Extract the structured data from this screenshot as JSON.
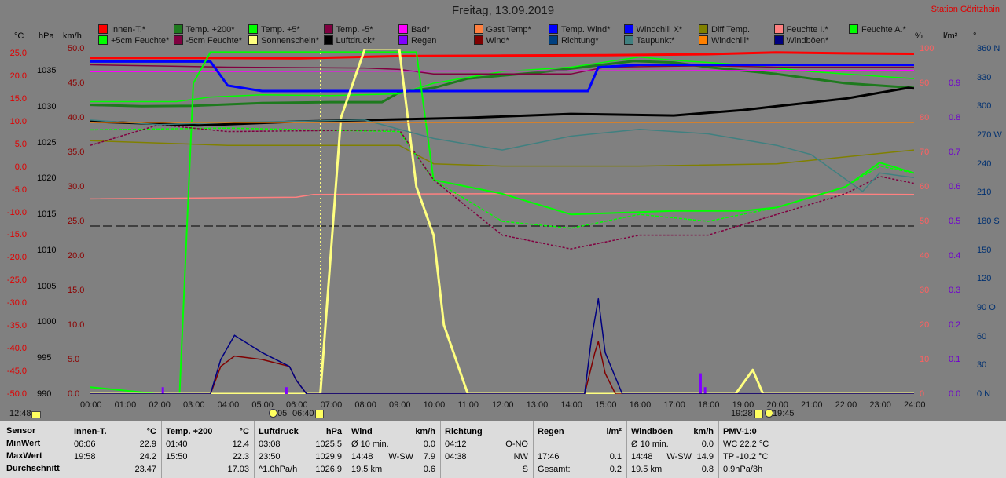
{
  "header": {
    "title": "Freitag, 13.09.2019",
    "station": "Station Göritzhain"
  },
  "legend": [
    {
      "label": "Innen-T.*",
      "color": "#ff0000"
    },
    {
      "label": "Temp. +200*",
      "color": "#1e7a1e"
    },
    {
      "label": "Temp. +5*",
      "color": "#00ff00"
    },
    {
      "label": "Temp. -5*",
      "color": "#800040"
    },
    {
      "label": "Bad*",
      "color": "#ff00ff"
    },
    {
      "label": "Gast Temp*",
      "color": "#ff8040"
    },
    {
      "label": "Temp. Wind*",
      "color": "#0000ff"
    },
    {
      "label": "Windchill X*",
      "color": "#0000ff"
    },
    {
      "label": "Diff Temp.",
      "color": "#808000"
    },
    {
      "label": "Feuchte I.*",
      "color": "#ff8080"
    },
    {
      "label": "Feuchte A.*",
      "color": "#00ff00"
    },
    {
      "label": "+5cm Feuchte*",
      "color": "#00ff00"
    },
    {
      "label": "-5cm Feuchte*",
      "color": "#800040"
    },
    {
      "label": "Sonnenschein*",
      "color": "#ffff80"
    },
    {
      "label": "Luftdruck*",
      "color": "#000000"
    },
    {
      "label": "Regen",
      "color": "#8000ff"
    },
    {
      "label": "Wind*",
      "color": "#800000"
    },
    {
      "label": "Richtung*",
      "color": "#004080"
    },
    {
      "label": "Taupunkt*",
      "color": "#408080"
    },
    {
      "label": "Windchill*",
      "color": "#ff8000"
    },
    {
      "label": "Windböen*",
      "color": "#000080"
    }
  ],
  "axes": {
    "temp_unit": "°C",
    "press_unit": "hPa",
    "wind_unit": "km/h",
    "hum_unit": "%",
    "rain_unit": "l/m²",
    "dir_unit": "°",
    "temp_ticks": [
      "25.0",
      "20.0",
      "15.0",
      "10.0",
      "5.0",
      "0.0",
      "-5.0",
      "-10.0",
      "-15.0",
      "-20.0",
      "-25.0",
      "-30.0",
      "-35.0",
      "-40.0",
      "-45.0",
      "-50.0"
    ],
    "press_ticks": [
      "1035",
      "1030",
      "1025",
      "1020",
      "1015",
      "1010",
      "1005",
      "1000",
      "995",
      "990"
    ],
    "wind_ticks": [
      "50.0",
      "45.0",
      "40.0",
      "35.0",
      "30.0",
      "25.0",
      "20.0",
      "15.0",
      "10.0",
      "5.0",
      "0.0"
    ],
    "hum_ticks": [
      "100",
      "90",
      "80",
      "70",
      "60",
      "50",
      "40",
      "30",
      "20",
      "10",
      "0"
    ],
    "rain_ticks": [
      "0.9",
      "0.8",
      "0.7",
      "0.6",
      "0.5",
      "0.4",
      "0.3",
      "0.2",
      "0.1",
      "0.0"
    ],
    "dir_ticks": [
      "360 N",
      "330",
      "300",
      "270 W",
      "240",
      "210",
      "180 S",
      "150",
      "120",
      "90 O",
      "60",
      "30",
      "0 N"
    ],
    "colors": {
      "temp": "#e00000",
      "press": "#000000",
      "wind": "#8b0000",
      "hum": "#ff6060",
      "rain": "#7000d0",
      "dir": "#003070"
    }
  },
  "bottom": {
    "start": "12:48",
    "sunrise": "05",
    "moonset": "06:40",
    "sunset": "19:28",
    "moonrise": "19:45"
  },
  "chart_data": {
    "type": "line",
    "title": "Freitag, 13.09.2019",
    "x_ticks": [
      "00:00",
      "01:00",
      "02:00",
      "03:00",
      "04:00",
      "05:00",
      "06:00",
      "07:00",
      "08:00",
      "09:00",
      "10:00",
      "11:00",
      "12:00",
      "13:00",
      "14:00",
      "15:00",
      "16:00",
      "17:00",
      "18:00",
      "19:00",
      "20:00",
      "21:00",
      "22:00",
      "23:00",
      "24:00"
    ],
    "xlim": [
      0,
      24
    ],
    "series": [
      {
        "name": "Innen-T.*",
        "axis": "temp",
        "values": [
          [
            0,
            23.0
          ],
          [
            3,
            23.0
          ],
          [
            6,
            22.9
          ],
          [
            9,
            23.4
          ],
          [
            12,
            23.5
          ],
          [
            15,
            23.6
          ],
          [
            18,
            23.8
          ],
          [
            19.97,
            24.2
          ],
          [
            22,
            24.0
          ],
          [
            24,
            23.9
          ]
        ]
      },
      {
        "name": "Temp. +200*",
        "axis": "temp",
        "values": [
          [
            0,
            12.8
          ],
          [
            1.5,
            12.5
          ],
          [
            3,
            12.6
          ],
          [
            5,
            13.2
          ],
          [
            7,
            13.4
          ],
          [
            8.5,
            13.4
          ],
          [
            9,
            15.5
          ],
          [
            10,
            16.5
          ],
          [
            11,
            18.5
          ],
          [
            13,
            19.8
          ],
          [
            15.83,
            22.3
          ],
          [
            17,
            22.0
          ],
          [
            18,
            21.0
          ],
          [
            20,
            19.5
          ],
          [
            22,
            17.5
          ],
          [
            24,
            16.5
          ]
        ]
      },
      {
        "name": "Temp. +5*",
        "axis": "temp",
        "values": [
          [
            0,
            13.5
          ],
          [
            2.5,
            13.5
          ],
          [
            3.5,
            14.5
          ],
          [
            5,
            15.0
          ],
          [
            7,
            14.8
          ],
          [
            9,
            15.2
          ],
          [
            10,
            17.5
          ],
          [
            12,
            20.0
          ],
          [
            14,
            21.0
          ],
          [
            16,
            23.2
          ],
          [
            17,
            22.5
          ],
          [
            19,
            21.5
          ],
          [
            19.5,
            21.2
          ],
          [
            21,
            20.0
          ],
          [
            24,
            18.5
          ]
        ]
      },
      {
        "name": "Temp. -5*",
        "axis": "temp",
        "values": [
          [
            0,
            21.5
          ],
          [
            4,
            21.0
          ],
          [
            8,
            20.8
          ],
          [
            9,
            20.5
          ],
          [
            10,
            19.5
          ],
          [
            12,
            19.5
          ],
          [
            14,
            19.5
          ],
          [
            15,
            21.0
          ],
          [
            18,
            21.3
          ],
          [
            20,
            21.0
          ],
          [
            24,
            21.0
          ]
        ]
      },
      {
        "name": "Bad*",
        "axis": "temp",
        "values": [
          [
            0,
            20.0
          ],
          [
            24,
            20.3
          ]
        ]
      },
      {
        "name": "Temp. Wind*",
        "axis": "temp",
        "values": [
          [
            0,
            22.2
          ],
          [
            3.5,
            22.2
          ],
          [
            4,
            17.0
          ],
          [
            5,
            15.8
          ],
          [
            7,
            15.8
          ],
          [
            14.5,
            15.8
          ],
          [
            14.8,
            21.0
          ],
          [
            16,
            21.5
          ],
          [
            24,
            21.5
          ]
        ]
      },
      {
        "name": "Diff Temp.",
        "axis": "temp",
        "values": [
          [
            0,
            5.0
          ],
          [
            4,
            4.0
          ],
          [
            9,
            4.0
          ],
          [
            10,
            0.0
          ],
          [
            12,
            -0.5
          ],
          [
            16,
            -0.5
          ],
          [
            20,
            0.0
          ],
          [
            24,
            3.0
          ]
        ]
      },
      {
        "name": "Feuchte I.*",
        "axis": "hum",
        "values": [
          [
            0,
            56.5
          ],
          [
            6,
            57.0
          ],
          [
            6.5,
            57.8
          ],
          [
            12,
            58.0
          ],
          [
            20,
            58.0
          ],
          [
            24,
            57.8
          ]
        ]
      },
      {
        "name": "Feuchte A.*",
        "axis": "hum",
        "values": [
          [
            0,
            2.0
          ],
          [
            2,
            0.0
          ],
          [
            2.6,
            0.0
          ],
          [
            3.0,
            90.0
          ],
          [
            3.5,
            99.0
          ],
          [
            9.5,
            99.0
          ],
          [
            10,
            62.0
          ],
          [
            12,
            58.0
          ],
          [
            14,
            52.0
          ],
          [
            17,
            53.0
          ],
          [
            19,
            53.0
          ],
          [
            20,
            54.0
          ],
          [
            22,
            60.0
          ],
          [
            23,
            67.0
          ],
          [
            24,
            64.0
          ]
        ]
      },
      {
        "name": "+5cm Feuchte*",
        "axis": "hum",
        "values": [
          [
            0,
            76.5
          ],
          [
            4,
            77.0
          ],
          [
            9,
            76.0
          ],
          [
            10,
            62.0
          ],
          [
            12,
            50.0
          ],
          [
            14,
            48.0
          ],
          [
            16,
            52.0
          ],
          [
            18,
            50.0
          ],
          [
            20,
            54.0
          ],
          [
            22,
            60.0
          ],
          [
            23,
            66.0
          ],
          [
            24,
            64.0
          ]
        ]
      },
      {
        "name": "-5cm Feuchte*",
        "axis": "hum",
        "values": [
          [
            0,
            72.0
          ],
          [
            2,
            78.0
          ],
          [
            4,
            76.0
          ],
          [
            9,
            76.5
          ],
          [
            10,
            62.0
          ],
          [
            12,
            46.0
          ],
          [
            14,
            42.0
          ],
          [
            16,
            46.0
          ],
          [
            18,
            46.0
          ],
          [
            20,
            52.0
          ],
          [
            22,
            58.0
          ],
          [
            23,
            63.0
          ],
          [
            24,
            61.0
          ]
        ]
      },
      {
        "name": "Sonnenschein*",
        "axis": "wind",
        "values": [
          [
            0,
            0
          ],
          [
            6.7,
            0
          ],
          [
            7.3,
            40
          ],
          [
            8,
            50
          ],
          [
            9,
            50
          ],
          [
            9.5,
            30
          ],
          [
            10,
            23
          ],
          [
            10.3,
            10
          ],
          [
            11,
            0
          ],
          [
            18.8,
            0
          ],
          [
            19.3,
            3.5
          ],
          [
            19.6,
            0
          ],
          [
            24,
            0
          ]
        ]
      },
      {
        "name": "Luftdruck*",
        "axis": "press",
        "values": [
          [
            0,
            1025.5
          ],
          [
            2,
            1025.2
          ],
          [
            3.13,
            1025.0
          ],
          [
            6,
            1025.5
          ],
          [
            9,
            1025.8
          ],
          [
            11,
            1026.0
          ],
          [
            14,
            1026.5
          ],
          [
            17,
            1026.3
          ],
          [
            19,
            1027.0
          ],
          [
            20,
            1027.5
          ],
          [
            22,
            1028.5
          ],
          [
            23.83,
            1029.9
          ],
          [
            24,
            1029.8
          ]
        ]
      },
      {
        "name": "Regen",
        "axis": "rain",
        "values": [
          [
            2.1,
            0.02
          ],
          [
            5.7,
            0.02
          ],
          [
            17.77,
            0.06
          ],
          [
            17.9,
            0.02
          ]
        ]
      },
      {
        "name": "Wind*",
        "axis": "wind",
        "values": [
          [
            0,
            0
          ],
          [
            3.5,
            0
          ],
          [
            3.8,
            4.0
          ],
          [
            4.2,
            5.5
          ],
          [
            5,
            5.0
          ],
          [
            5.8,
            4.0
          ],
          [
            6,
            2.0
          ],
          [
            6.3,
            0
          ],
          [
            14.4,
            0
          ],
          [
            14.7,
            6.0
          ],
          [
            14.8,
            7.6
          ],
          [
            15,
            3.0
          ],
          [
            15.3,
            0
          ],
          [
            24,
            0
          ]
        ]
      },
      {
        "name": "Taupunkt*",
        "axis": "temp",
        "values": [
          [
            0,
            9.5
          ],
          [
            2,
            8.5
          ],
          [
            4,
            9.0
          ],
          [
            8,
            9.5
          ],
          [
            10,
            5.5
          ],
          [
            12,
            3.0
          ],
          [
            14,
            6.0
          ],
          [
            16,
            7.5
          ],
          [
            18,
            6.5
          ],
          [
            20,
            4.0
          ],
          [
            21,
            2.0
          ],
          [
            22.5,
            -6.0
          ],
          [
            23,
            -2.0
          ],
          [
            24,
            -3.0
          ]
        ]
      },
      {
        "name": "Windböen*",
        "axis": "wind",
        "values": [
          [
            0,
            0
          ],
          [
            3.5,
            0
          ],
          [
            3.8,
            5.0
          ],
          [
            4.2,
            8.5
          ],
          [
            5,
            6.0
          ],
          [
            5.8,
            4.0
          ],
          [
            6,
            2.0
          ],
          [
            6.3,
            0
          ],
          [
            14.4,
            0
          ],
          [
            14.6,
            8.0
          ],
          [
            14.8,
            13.8
          ],
          [
            15,
            6.0
          ],
          [
            15.5,
            0
          ],
          [
            24,
            0
          ]
        ]
      },
      {
        "name": "Windchill*",
        "axis": "temp",
        "values": [
          [
            0,
            9.0
          ],
          [
            24,
            9.0
          ]
        ]
      }
    ]
  },
  "stats": {
    "rows": [
      "Sensor",
      "MinWert",
      "MaxWert",
      "Durchschnitt"
    ],
    "cols": [
      {
        "title": "Innen-T.",
        "unit": "°C",
        "cells": [
          [
            "06:06",
            "",
            "22.9"
          ],
          [
            "19:58",
            "",
            "24.2"
          ],
          [
            "",
            "",
            "23.47"
          ]
        ]
      },
      {
        "title": "Temp. +200",
        "unit": "°C",
        "cells": [
          [
            "01:40",
            "",
            "12.4"
          ],
          [
            "15:50",
            "",
            "22.3"
          ],
          [
            "",
            "",
            "17.03"
          ]
        ]
      },
      {
        "title": "Luftdruck",
        "unit": "hPa",
        "cells": [
          [
            "03:08",
            "",
            "1025.5"
          ],
          [
            "23:50",
            "",
            "1029.9"
          ],
          [
            "^1.0hPa/h",
            "",
            "1026.9"
          ]
        ]
      },
      {
        "title": "Wind",
        "unit": "km/h",
        "cells": [
          [
            "Ø 10 min.",
            "",
            "0.0"
          ],
          [
            "14:48",
            "W-SW",
            "7.9"
          ],
          [
            "19.5 km",
            "",
            "0.6"
          ]
        ]
      },
      {
        "title": "Richtung",
        "unit": "",
        "cells": [
          [
            "04:12",
            "",
            "O-NO"
          ],
          [
            "04:38",
            "",
            "NW"
          ],
          [
            "",
            "",
            "S"
          ]
        ]
      },
      {
        "title": "Regen",
        "unit": "l/m²",
        "cells": [
          [
            "",
            "",
            ""
          ],
          [
            "17:46",
            "",
            "0.1"
          ],
          [
            "Gesamt:",
            "",
            "0.2"
          ]
        ]
      },
      {
        "title": "Windböen",
        "unit": "km/h",
        "cells": [
          [
            "Ø 10 min.",
            "",
            "0.0"
          ],
          [
            "14:48",
            "W-SW",
            "14.9"
          ],
          [
            "19.5 km",
            "",
            "0.8"
          ]
        ]
      },
      {
        "title": "PMV-1:0",
        "unit": "",
        "cells": [
          [
            "WC 22.2 °C",
            "",
            ""
          ],
          [
            "TP -10.2 °C",
            "",
            ""
          ],
          [
            "0.9hPa/3h",
            "",
            ""
          ]
        ]
      }
    ]
  }
}
